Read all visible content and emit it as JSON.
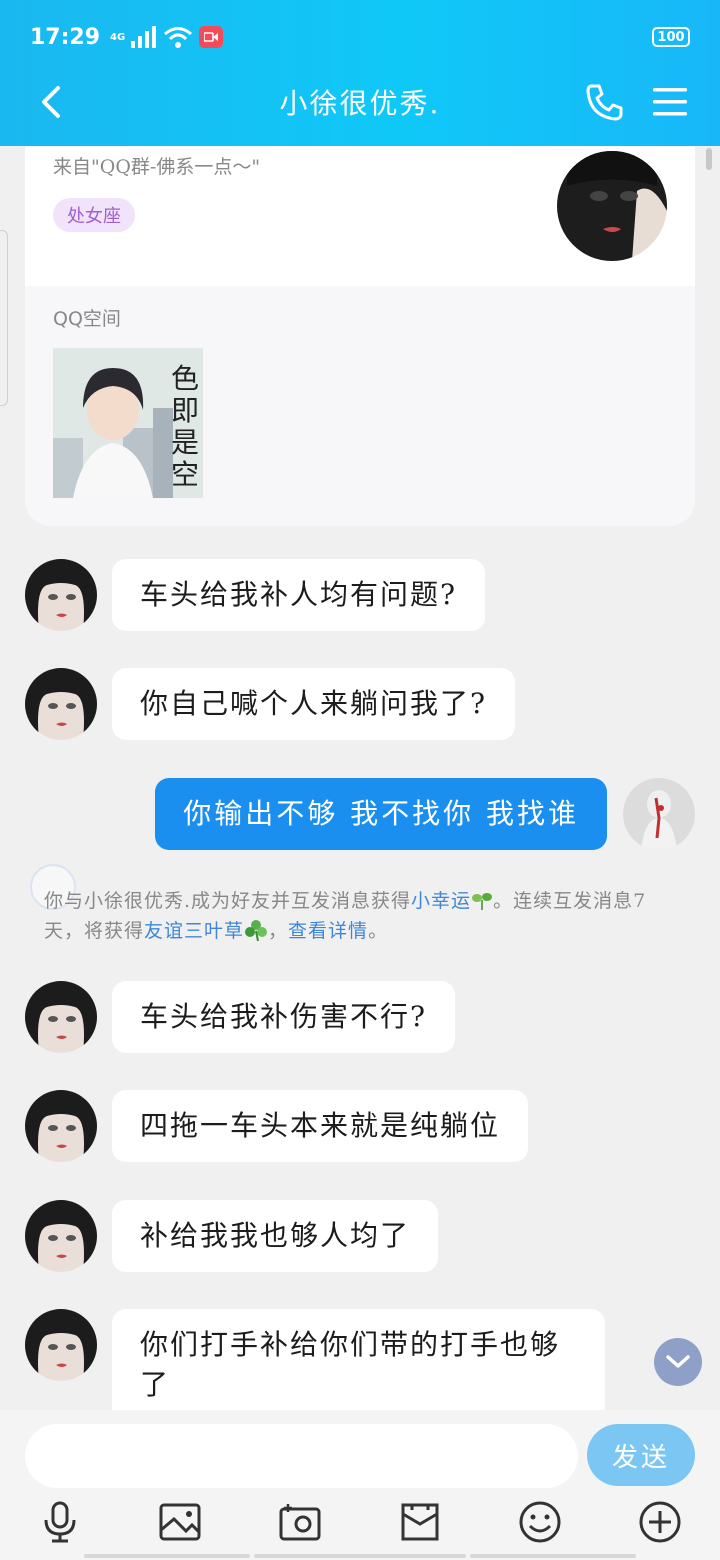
{
  "status_bar": {
    "time": "17:29",
    "network": "4G",
    "battery": "100"
  },
  "header": {
    "title": "小徐很优秀."
  },
  "profile_card": {
    "from_text": "来自\"QQ群-佛系一点～\"",
    "tag": "处女座",
    "space_label": "QQ空间"
  },
  "messages": [
    {
      "side": "in",
      "text": "车头给我补人均有问题?"
    },
    {
      "side": "in",
      "text": "你自己喊个人来躺问我了?"
    },
    {
      "side": "out",
      "text": "你输出不够 我不找你 我找谁"
    },
    {
      "side": "in",
      "text": "车头给我补伤害不行?"
    },
    {
      "side": "in",
      "text": "四拖一车头本来就是纯躺位"
    },
    {
      "side": "in",
      "text": "补给我我也够人均了"
    },
    {
      "side": "in",
      "text": "你们打手补给你们带的打手也够了"
    }
  ],
  "system_notice": {
    "part1": "你与小徐很优秀.成为好友并互发消息获得",
    "link1": "小幸运",
    "part2": "。连续互发消息7天，将获得",
    "link2": "友谊三叶草",
    "part3": "，",
    "link3": "查看详情",
    "part4": "。"
  },
  "input": {
    "send_label": "发送"
  },
  "colors": {
    "header": "#10c8f8",
    "out_bubble": "#1a8ff0",
    "send_button": "#7cc6f4",
    "link": "#3f87d6"
  },
  "icons": [
    "back-icon",
    "phone-icon",
    "menu-icon",
    "mic-icon",
    "image-icon",
    "camera-icon",
    "folder-icon",
    "emoji-icon",
    "plus-icon"
  ]
}
